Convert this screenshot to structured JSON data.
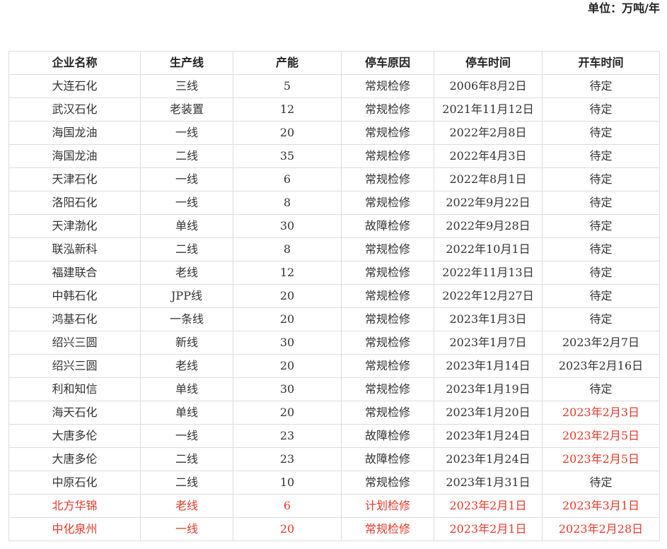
{
  "unit_label": "单位：万吨/年",
  "table": {
    "headers": [
      "企业名称",
      "生产线",
      "产能",
      "停车原因",
      "停车时间",
      "开车时间"
    ],
    "rows": [
      {
        "cells": [
          "大连石化",
          "三线",
          "5",
          "常规检修",
          "2006年8月2日",
          "待定"
        ],
        "highlight_row": false,
        "highlight_cells": []
      },
      {
        "cells": [
          "武汉石化",
          "老装置",
          "12",
          "常规检修",
          "2021年11月12日",
          "待定"
        ],
        "highlight_row": false,
        "highlight_cells": []
      },
      {
        "cells": [
          "海国龙油",
          "一线",
          "20",
          "常规检修",
          "2022年2月8日",
          "待定"
        ],
        "highlight_row": false,
        "highlight_cells": []
      },
      {
        "cells": [
          "海国龙油",
          "二线",
          "35",
          "常规检修",
          "2022年4月3日",
          "待定"
        ],
        "highlight_row": false,
        "highlight_cells": []
      },
      {
        "cells": [
          "天津石化",
          "一线",
          "6",
          "常规检修",
          "2022年8月1日",
          "待定"
        ],
        "highlight_row": false,
        "highlight_cells": []
      },
      {
        "cells": [
          "洛阳石化",
          "一线",
          "8",
          "常规检修",
          "2022年9月22日",
          "待定"
        ],
        "highlight_row": false,
        "highlight_cells": []
      },
      {
        "cells": [
          "天津渤化",
          "单线",
          "30",
          "故障检修",
          "2022年9月28日",
          "待定"
        ],
        "highlight_row": false,
        "highlight_cells": []
      },
      {
        "cells": [
          "联泓新科",
          "二线",
          "8",
          "常规检修",
          "2022年10月1日",
          "待定"
        ],
        "highlight_row": false,
        "highlight_cells": []
      },
      {
        "cells": [
          "福建联合",
          "老线",
          "12",
          "常规检修",
          "2022年11月13日",
          "待定"
        ],
        "highlight_row": false,
        "highlight_cells": []
      },
      {
        "cells": [
          "中韩石化",
          "JPP线",
          "20",
          "常规检修",
          "2022年12月27日",
          "待定"
        ],
        "highlight_row": false,
        "highlight_cells": []
      },
      {
        "cells": [
          "鸿基石化",
          "一条线",
          "20",
          "常规检修",
          "2023年1月3日",
          "待定"
        ],
        "highlight_row": false,
        "highlight_cells": []
      },
      {
        "cells": [
          "绍兴三圆",
          "新线",
          "30",
          "常规检修",
          "2023年1月7日",
          "2023年2月7日"
        ],
        "highlight_row": false,
        "highlight_cells": []
      },
      {
        "cells": [
          "绍兴三圆",
          "老线",
          "20",
          "常规检修",
          "2023年1月14日",
          "2023年2月16日"
        ],
        "highlight_row": false,
        "highlight_cells": []
      },
      {
        "cells": [
          "利和知信",
          "单线",
          "30",
          "常规检修",
          "2023年1月19日",
          "待定"
        ],
        "highlight_row": false,
        "highlight_cells": []
      },
      {
        "cells": [
          "海天石化",
          "单线",
          "20",
          "常规检修",
          "2023年1月20日",
          "2023年2月3日"
        ],
        "highlight_row": false,
        "highlight_cells": [
          5
        ]
      },
      {
        "cells": [
          "大唐多伦",
          "一线",
          "23",
          "故障检修",
          "2023年1月24日",
          "2023年2月5日"
        ],
        "highlight_row": false,
        "highlight_cells": [
          5
        ]
      },
      {
        "cells": [
          "大唐多伦",
          "二线",
          "23",
          "故障检修",
          "2023年1月24日",
          "2023年2月5日"
        ],
        "highlight_row": false,
        "highlight_cells": [
          5
        ]
      },
      {
        "cells": [
          "中原石化",
          "二线",
          "10",
          "常规检修",
          "2023年1月31日",
          "待定"
        ],
        "highlight_row": false,
        "highlight_cells": []
      },
      {
        "cells": [
          "北方华锦",
          "老线",
          "6",
          "计划检修",
          "2023年2月1日",
          "2023年3月1日"
        ],
        "highlight_row": true,
        "highlight_cells": []
      },
      {
        "cells": [
          "中化泉州",
          "一线",
          "20",
          "常规检修",
          "2023年2月1日",
          "2023年2月28日"
        ],
        "highlight_row": true,
        "highlight_cells": []
      }
    ]
  },
  "colors": {
    "highlight": "#e83828",
    "text": "#333333",
    "border": "#dcdcdc"
  }
}
